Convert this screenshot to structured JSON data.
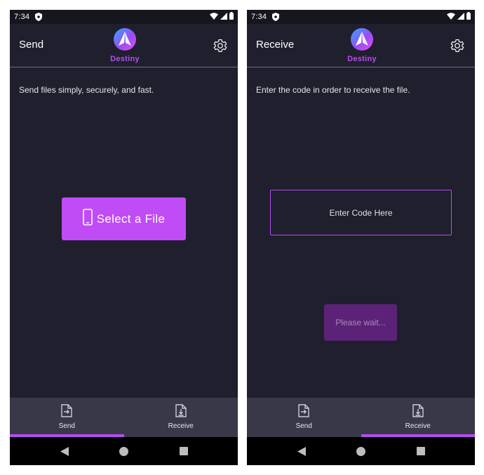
{
  "colors": {
    "accent": "#c04cf5",
    "background": "#1f1f2d",
    "nav_bar": "#383848",
    "disabled": "#5c2278"
  },
  "status_bar": {
    "time": "7:34"
  },
  "app": {
    "logo_text": "Destiny"
  },
  "send_screen": {
    "title": "Send",
    "subtitle": "Send files simply, securely, and fast.",
    "select_button": "Select a File"
  },
  "receive_screen": {
    "title": "Receive",
    "subtitle": "Enter the code in order to receive the file.",
    "code_placeholder": "Enter Code Here",
    "wait_button": "Please wait..."
  },
  "bottom_nav": [
    {
      "label": "Send",
      "icon": "send-file-icon"
    },
    {
      "label": "Receive",
      "icon": "receive-file-icon"
    }
  ],
  "system_nav": [
    "back-icon",
    "home-icon",
    "recents-icon"
  ]
}
